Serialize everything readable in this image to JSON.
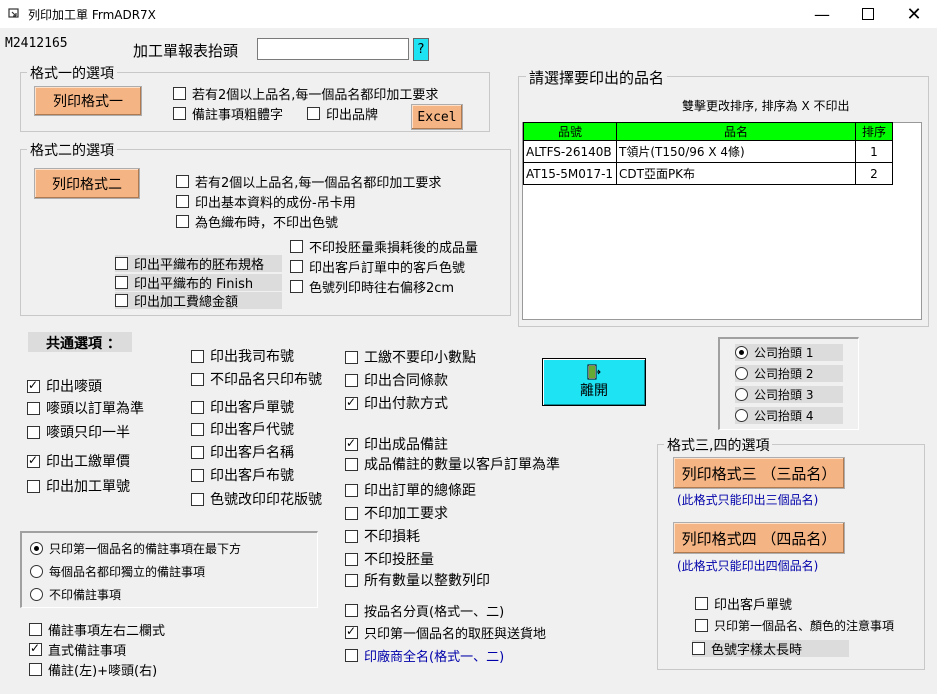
{
  "window": {
    "title": "列印加工單 FrmADR7X",
    "minimize_icon": "minimize-icon",
    "maximize_icon": "maximize-icon",
    "close_icon": "close-icon"
  },
  "top": {
    "doc_no": "M2412165",
    "header_label": "加工單報表抬頭",
    "header_value": "",
    "help_btn": "?"
  },
  "fmt1": {
    "legend": "格式一的選項",
    "print_btn": "列印格式一",
    "opt1": "若有2個以上品名,每一個品名都印加工要求",
    "opt2": "備註事項粗體字",
    "opt3": "印出品牌",
    "excel_btn": "Excel"
  },
  "fmt2": {
    "legend": "格式二的選項",
    "print_btn": "列印格式二",
    "opt1": "若有2個以上品名,每一個品名都印加工要求",
    "opt2": "印出基本資料的成份-吊卡用",
    "opt3": "為色織布時，不印出色號",
    "opt4": "不印投胚量乘損耗後的成品量",
    "opt5": "印出客戶訂單中的客戶色號",
    "opt6": "色號列印時往右偏移2cm",
    "opt7": "印出平織布的胚布規格",
    "opt8": "印出平織布的 Finish",
    "opt9": "印出加工費總金額"
  },
  "select": {
    "legend": "請選擇要印出的品名",
    "hint": "雙擊更改排序, 排序為 X 不印出",
    "columns": [
      "品號",
      "品名",
      "排序"
    ],
    "rows": [
      [
        "ALTFS-26140B",
        "T領片(T150/96 X 4條)",
        "1"
      ],
      [
        "AT15-5M017-1",
        "CDT亞面PK布",
        "2"
      ]
    ]
  },
  "common": {
    "title": "共通選項 ：",
    "col1": [
      {
        "label": "印出嘜頭",
        "checked": true
      },
      {
        "label": "嘜頭以訂單為準",
        "checked": false
      },
      {
        "label": "嘜頭只印一半",
        "checked": false
      },
      {
        "label": "印出工繳單價",
        "checked": true
      },
      {
        "label": "印出加工單號",
        "checked": false
      }
    ],
    "col2": [
      {
        "label": "印出我司布號",
        "checked": false
      },
      {
        "label": "不印品名只印布號",
        "checked": false
      },
      {
        "label": "印出客戶單號",
        "checked": false
      },
      {
        "label": "印出客戶代號",
        "checked": false
      },
      {
        "label": "印出客戶名稱",
        "checked": false
      },
      {
        "label": "印出客戶布號",
        "checked": false
      },
      {
        "label": "色號改印印花版號",
        "checked": false
      }
    ],
    "col3a": [
      {
        "label": "工繳不要印小數點",
        "checked": false
      },
      {
        "label": "印出合同條款",
        "checked": false
      },
      {
        "label": "印出付款方式",
        "checked": true
      }
    ],
    "col3b": [
      {
        "label": "印出成品備註",
        "checked": true
      },
      {
        "label": "成品備註的數量以客戶訂單為準",
        "checked": false
      },
      {
        "label": "印出訂單的總條距",
        "checked": false
      },
      {
        "label": "不印加工要求",
        "checked": false
      },
      {
        "label": "不印損耗",
        "checked": false
      },
      {
        "label": "不印投胚量",
        "checked": false
      },
      {
        "label": "所有數量以整數列印",
        "checked": false
      }
    ],
    "col3c": [
      {
        "label": "按品名分頁(格式一、二)",
        "checked": false
      },
      {
        "label": "只印第一個品名的取胚與送貨地",
        "checked": true
      },
      {
        "label": "印廠商全名(格式一、二)",
        "checked": false
      }
    ],
    "exit_btn": "離開",
    "exit_icon": "exit-door-icon"
  },
  "remarks": {
    "radios": [
      {
        "label": "只印第一個品名的備註事項在最下方",
        "checked": true
      },
      {
        "label": "每個品名都印獨立的備註事項",
        "checked": false
      },
      {
        "label": "不印備註事項",
        "checked": false
      }
    ],
    "checks": [
      {
        "label": "備註事項左右二欄式",
        "checked": false
      },
      {
        "label": "直式備註事項",
        "checked": true
      },
      {
        "label": "備註(左)+嘜頭(右)",
        "checked": false
      }
    ]
  },
  "company": {
    "radios": [
      {
        "label": "公司抬頭 1",
        "checked": true
      },
      {
        "label": "公司抬頭 2",
        "checked": false
      },
      {
        "label": "公司抬頭 3",
        "checked": false
      },
      {
        "label": "公司抬頭 4",
        "checked": false
      }
    ]
  },
  "fmt34": {
    "legend": "格式三,四的選項",
    "print3_btn": "列印格式三 （三品名）",
    "note3": "(此格式只能印出三個品名)",
    "print4_btn": "列印格式四 （四品名）",
    "note4": "(此格式只能印出四個品名)",
    "opt1": "印出客戶單號",
    "opt2": "只印第一個品名、顏色的注意事項",
    "opt3": "色號字樣太長時"
  }
}
